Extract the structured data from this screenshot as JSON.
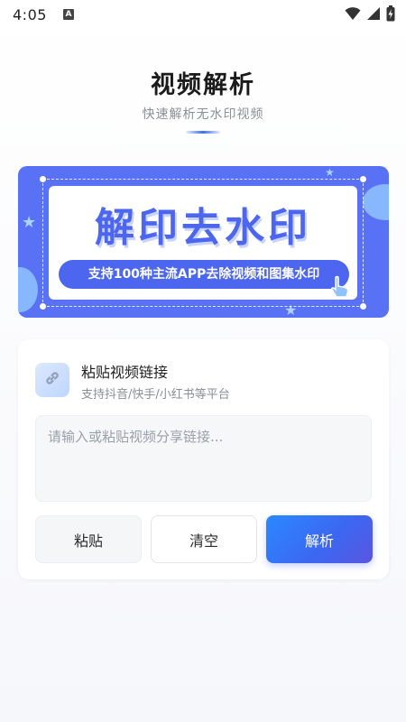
{
  "status_bar": {
    "time": "4:05",
    "notification_badge": "A",
    "icons": [
      "wifi-icon",
      "signal-icon",
      "battery-charging-icon"
    ]
  },
  "header": {
    "title": "视频解析",
    "subtitle": "快速解析无水印视频"
  },
  "banner": {
    "headline": "解印去水印",
    "tagline": "支持100种主流APP去除视频和图集水印",
    "accent_color": "#5871f5"
  },
  "input_card": {
    "title": "粘贴视频链接",
    "subtitle": "支持抖音/快手/小红书等平台",
    "icon": "link-icon",
    "input": {
      "value": "",
      "placeholder": "请输入或粘贴视频分享链接..."
    },
    "buttons": {
      "paste_label": "粘贴",
      "clear_label": "清空",
      "parse_label": "解析"
    }
  },
  "colors": {
    "primary": "#3d66f0",
    "text_secondary": "#8a8f99"
  }
}
